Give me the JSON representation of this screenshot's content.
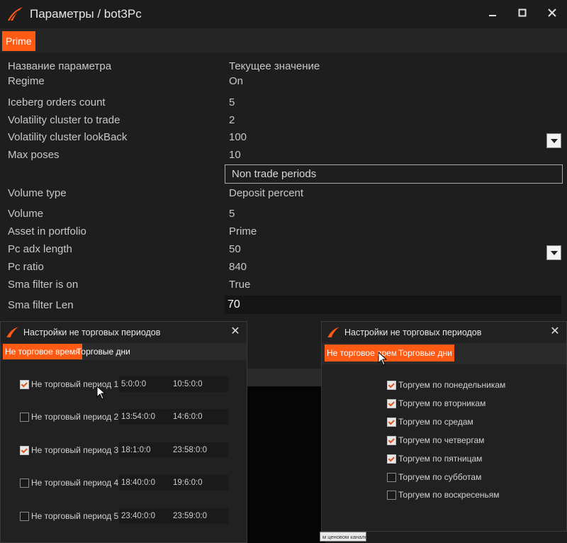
{
  "window": {
    "title": "Параметры / bot3Pc",
    "tab": "Prime"
  },
  "grid": {
    "header_name": "Название параметра",
    "header_value": "Текущее значение",
    "rows": [
      {
        "name": "Regime",
        "value": "On"
      },
      {
        "name": "Iceberg orders count",
        "value": "5"
      },
      {
        "name": "Volatility cluster to trade",
        "value": "2"
      },
      {
        "name": "Volatility cluster lookBack",
        "value": "100"
      },
      {
        "name": "Max poses",
        "value": "10"
      },
      {
        "name": "",
        "value": "Non trade periods"
      },
      {
        "name": "Volume type",
        "value": "Deposit percent"
      },
      {
        "name": "Volume",
        "value": "5"
      },
      {
        "name": "Asset in portfolio",
        "value": "Prime"
      },
      {
        "name": "Pc adx length",
        "value": "50"
      },
      {
        "name": "Pc ratio",
        "value": "840"
      },
      {
        "name": "Sma filter is on",
        "value": "True"
      },
      {
        "name": "Sma filter Len",
        "value": "70"
      }
    ]
  },
  "dialog_left": {
    "title": "Настройки не торговых периодов",
    "tab_time": "Не торговое время",
    "tab_days": "Торговые дни",
    "periods": [
      {
        "label": "Не торговый период 1",
        "checked": true,
        "start": "5:0:0:0",
        "end": "10:5:0:0"
      },
      {
        "label": "Не торговый период 2",
        "checked": false,
        "start": "13:54:0:0",
        "end": "14:6:0:0"
      },
      {
        "label": "Не торговый период 3",
        "checked": true,
        "start": "18:1:0:0",
        "end": "23:58:0:0"
      },
      {
        "label": "Не торговый период 4",
        "checked": false,
        "start": "18:40:0:0",
        "end": "19:6:0:0"
      },
      {
        "label": "Не торговый период 5",
        "checked": false,
        "start": "23:40:0:0",
        "end": "23:59:0:0"
      }
    ]
  },
  "dialog_right": {
    "title": "Настройки не торговых периодов",
    "tab_time": "Не торговое время",
    "tab_days": "Торговые дни",
    "days": [
      {
        "label": "Торгуем по понедельникам",
        "checked": true
      },
      {
        "label": "Торгуем по вторникам",
        "checked": true
      },
      {
        "label": "Торгуем по средам",
        "checked": true
      },
      {
        "label": "Торгуем по четвергам",
        "checked": true
      },
      {
        "label": "Торгуем по пятницам",
        "checked": true
      },
      {
        "label": "Торгуем по субботам",
        "checked": false
      },
      {
        "label": "Торгуем по воскресеньям",
        "checked": false
      }
    ]
  },
  "tooltip": "м ценовом канале",
  "colors": {
    "accent": "#ff5a14",
    "background": "#1e1e1e"
  }
}
